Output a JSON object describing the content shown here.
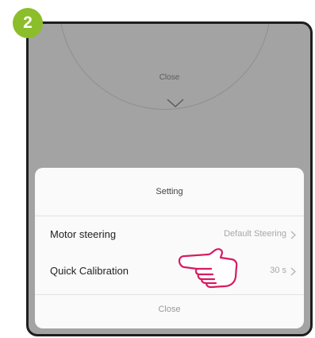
{
  "step_badge": "2",
  "dial": {
    "close_label": "Close",
    "chevron_icon": "chevron-down-icon"
  },
  "sheet": {
    "title": "Setting",
    "rows": [
      {
        "label": "Motor steering",
        "value": "Default Steering",
        "icon": "chevron-right-icon"
      },
      {
        "label": "Quick Calibration",
        "value": "30 s",
        "icon": "chevron-right-icon"
      }
    ],
    "close_label": "Close"
  },
  "pointer": {
    "icon": "pointing-hand-icon",
    "color": "#d81b60"
  },
  "colors": {
    "badge": "#8cbd2a",
    "overlay": "#a3a3a3",
    "sheet": "#fafafa"
  }
}
